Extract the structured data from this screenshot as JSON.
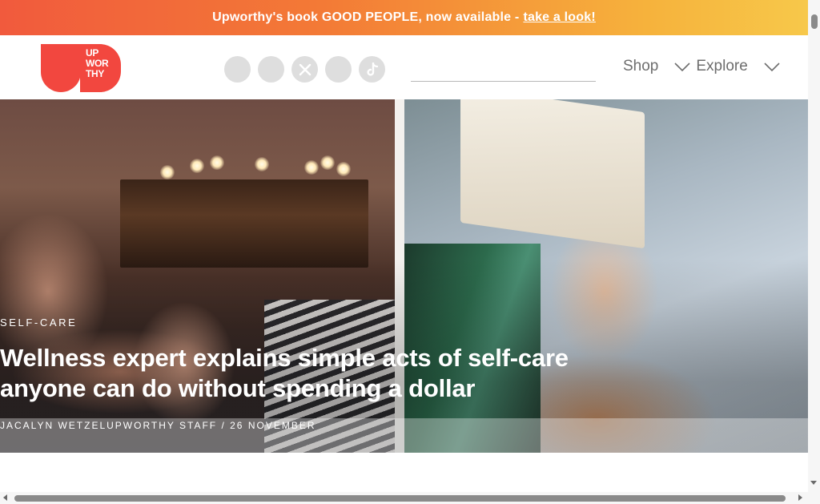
{
  "banner": {
    "text": "Upworthy's book GOOD PEOPLE, now available -",
    "link_text": "take a look!"
  },
  "header": {
    "logo": {
      "line1": "UP",
      "line2": "WOR",
      "line3": "THY",
      "color": "#f2473f"
    },
    "social_icons": [
      {
        "icon": "facebook-icon"
      },
      {
        "icon": "instagram-icon"
      },
      {
        "icon": "x-twitter-icon"
      },
      {
        "icon": "youtube-icon"
      },
      {
        "icon": "tiktok-icon"
      }
    ],
    "search": {
      "placeholder": "",
      "value": ""
    },
    "nav": [
      {
        "label": "Shop"
      },
      {
        "label": "Explore"
      }
    ]
  },
  "hero": {
    "category": "SELF-CARE",
    "headline": "Wellness expert explains simple acts of self-care anyone can do without spending a dollar",
    "byline": "JACALYN WETZELUPWORTHY STAFF / 26 NOVEMBER"
  },
  "colors": {
    "banner_start": "#f15a3d",
    "banner_end": "#f7c84a",
    "brand": "#f2473f",
    "nav_text": "#6e6e6e",
    "social_circle": "#dedede"
  }
}
